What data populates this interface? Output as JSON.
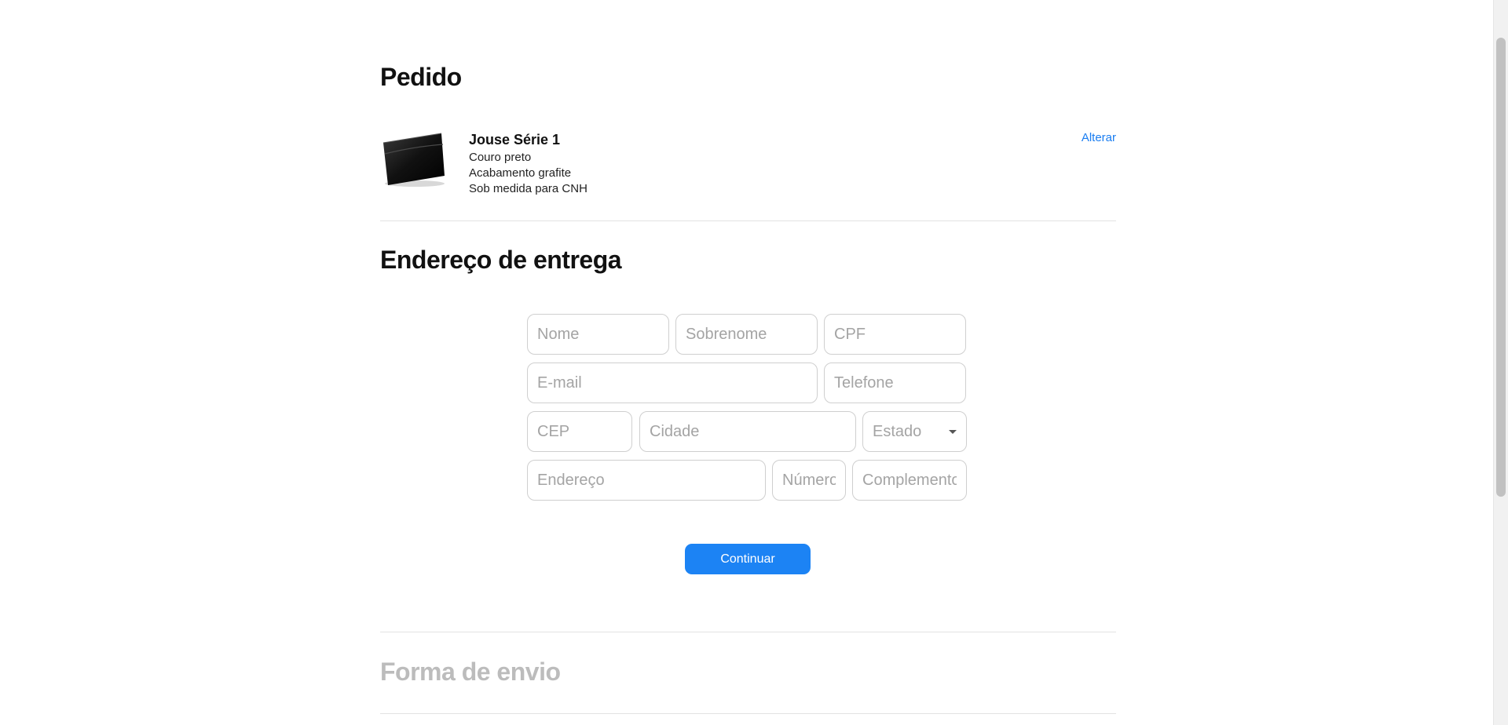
{
  "order": {
    "title": "Pedido",
    "product": {
      "name": "Jouse Série 1",
      "details": [
        "Couro preto",
        "Acabamento grafite",
        "Sob medida para CNH"
      ]
    },
    "change_link": "Alterar"
  },
  "shipping_address": {
    "title": "Endereço de entrega",
    "fields": {
      "first_name": "Nome",
      "last_name": "Sobrenome",
      "cpf": "CPF",
      "email": "E-mail",
      "phone": "Telefone",
      "cep": "CEP",
      "city": "Cidade",
      "state": "Estado",
      "address": "Endereço",
      "number": "Número",
      "complement": "Complemento"
    },
    "continue_label": "Continuar"
  },
  "shipping_method": {
    "title": "Forma de envio"
  },
  "colors": {
    "accent": "#1c83f4",
    "link": "#1a7df1",
    "disabled_heading": "#bcbcbc"
  }
}
